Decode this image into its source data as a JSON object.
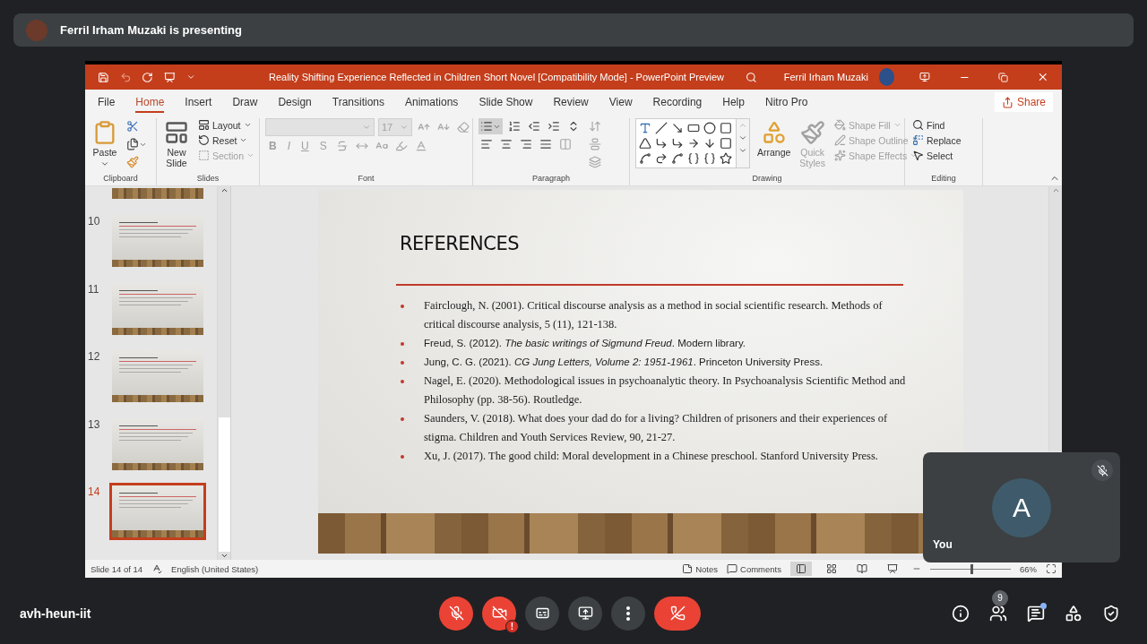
{
  "banner": {
    "presenter": "Ferril Irham Muzaki is presenting"
  },
  "window": {
    "title": "Reality Shifting Experience Reflected in Children Short Novel [Compatibility Mode] - PowerPoint Preview",
    "user": "Ferril Irham Muzaki"
  },
  "tabs": [
    {
      "label": "File",
      "selected": false
    },
    {
      "label": "Home",
      "selected": true
    },
    {
      "label": "Insert",
      "selected": false
    },
    {
      "label": "Draw",
      "selected": false
    },
    {
      "label": "Design",
      "selected": false
    },
    {
      "label": "Transitions",
      "selected": false
    },
    {
      "label": "Animations",
      "selected": false
    },
    {
      "label": "Slide Show",
      "selected": false
    },
    {
      "label": "Review",
      "selected": false
    },
    {
      "label": "View",
      "selected": false
    },
    {
      "label": "Recording",
      "selected": false
    },
    {
      "label": "Help",
      "selected": false
    },
    {
      "label": "Nitro Pro",
      "selected": false
    }
  ],
  "share_button": "Share",
  "ribbon": {
    "clipboard": {
      "label": "Clipboard",
      "paste": "Paste"
    },
    "slides": {
      "label": "Slides",
      "new_slide": "New Slide",
      "items": [
        {
          "label": "Layout",
          "disabled": false
        },
        {
          "label": "Reset",
          "disabled": false
        },
        {
          "label": "Section",
          "disabled": true
        }
      ]
    },
    "font": {
      "label": "Font",
      "disabled": true,
      "font_size": "17",
      "format_letters": [
        "B",
        "I",
        "U",
        "S"
      ]
    },
    "paragraph": {
      "label": "Paragraph"
    },
    "drawing": {
      "label": "Drawing",
      "arrange": "Arrange",
      "quick_styles": {
        "label": "Quick Styles",
        "disabled": true
      },
      "shape_items": [
        {
          "label": "Shape Fill",
          "disabled": true
        },
        {
          "label": "Shape Outline",
          "disabled": true
        },
        {
          "label": "Shape Effects",
          "disabled": true
        }
      ]
    },
    "editing": {
      "label": "Editing",
      "items": [
        {
          "label": "Find"
        },
        {
          "label": "Replace"
        },
        {
          "label": "Select"
        }
      ]
    }
  },
  "thumbnails": [
    {
      "number": "10",
      "selected": false
    },
    {
      "number": "11",
      "selected": false
    },
    {
      "number": "12",
      "selected": false
    },
    {
      "number": "13",
      "selected": false
    },
    {
      "number": "14",
      "selected": true
    }
  ],
  "slide": {
    "title": "REFERENCES",
    "references": [
      {
        "kind": "serif",
        "text": "Fairclough, N. (2001). Critical discourse analysis as a method in social scientific research. Methods of critical discourse analysis, 5 (11), 121-138."
      },
      {
        "kind": "sans",
        "text": "Freud, S. (2012). *The basic writings of Sigmund Freud*. Modern library."
      },
      {
        "kind": "sans",
        "text": "Jung, C. G. (2021). *CG Jung Letters, Volume 2: 1951-1961*. Princeton University Press."
      },
      {
        "kind": "serif",
        "text": "Nagel, E. (2020). Methodological issues in psychoanalytic theory. In Psychoanalysis Scientific Method and Philosophy (pp. 38-56). Routledge."
      },
      {
        "kind": "serif",
        "text": "Saunders, V. (2018). What does your dad do for a living? Children of prisoners and their experiences of stigma. Children and Youth Services Review, 90, 21-27."
      },
      {
        "kind": "serif",
        "text": "Xu, J. (2017). The good child: Moral development in a Chinese preschool. Stanford University Press."
      }
    ]
  },
  "status_bar": {
    "slide_info": "Slide 14 of 14",
    "language": "English (United States)",
    "notes": "Notes",
    "comments": "Comments",
    "views": [
      {
        "selected": true
      },
      {
        "selected": false
      },
      {
        "selected": false
      },
      {
        "selected": false
      }
    ],
    "zoom": {
      "level": 0.5,
      "reading": "66%"
    }
  },
  "self_view": {
    "initial": "A",
    "label": "You",
    "muted": true
  },
  "call_bar": {
    "meeting_code": "avh-heun-iit",
    "mic_on": false,
    "camera_on": false,
    "camera_alert": "!",
    "participants_count": "9",
    "chat_unread": true
  }
}
